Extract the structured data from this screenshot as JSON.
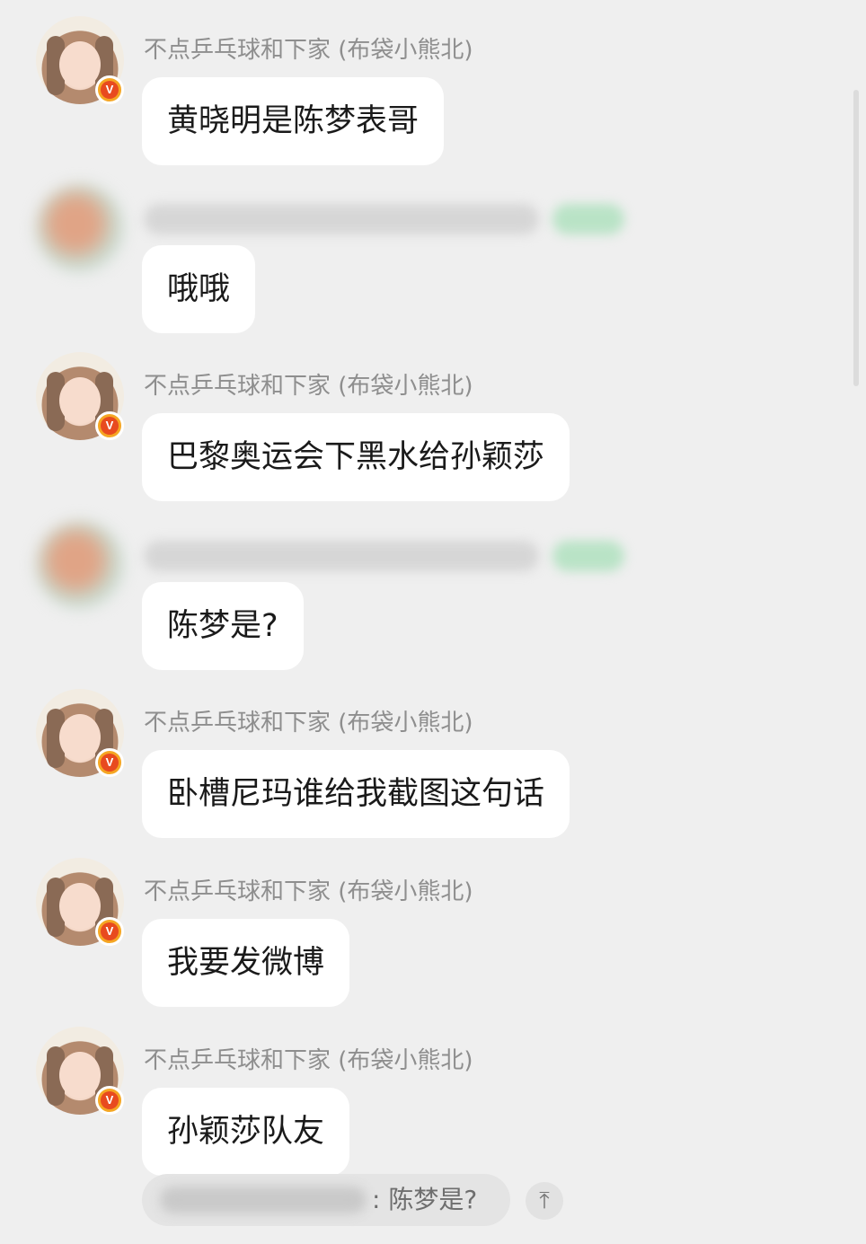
{
  "messages": [
    {
      "sender": "不点乒乓球和下家 (布袋小熊北)",
      "text": "黄晓明是陈梦表哥",
      "verified": true,
      "hidden_sender": false
    },
    {
      "sender": "",
      "text": "哦哦",
      "verified": false,
      "hidden_sender": true
    },
    {
      "sender": "不点乒乓球和下家 (布袋小熊北)",
      "text": "巴黎奥运会下黑水给孙颖莎",
      "verified": true,
      "hidden_sender": false
    },
    {
      "sender": "",
      "text": "陈梦是?",
      "verified": false,
      "hidden_sender": true
    },
    {
      "sender": "不点乒乓球和下家 (布袋小熊北)",
      "text": "卧槽尼玛谁给我截图这句话",
      "verified": true,
      "hidden_sender": false
    },
    {
      "sender": "不点乒乓球和下家 (布袋小熊北)",
      "text": "我要发微博",
      "verified": true,
      "hidden_sender": false
    },
    {
      "sender": "不点乒乓球和下家 (布袋小熊北)",
      "text": "孙颖莎队友",
      "verified": true,
      "hidden_sender": false
    }
  ],
  "badge_letter": "V",
  "reply_preview": {
    "text": ": 陈梦是?"
  },
  "scroll_top_icon": "arrow-up-to-top-icon",
  "scroll_top_glyph": "⤒",
  "colors": {
    "background": "#efefef",
    "bubble": "#ffffff",
    "name": "#8e8e8e",
    "badge": "#e84a1f"
  }
}
